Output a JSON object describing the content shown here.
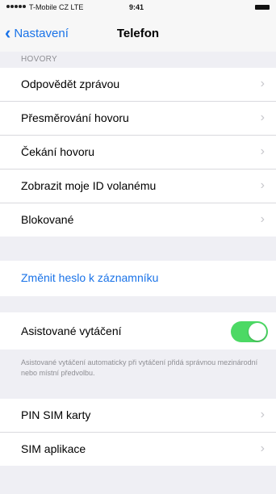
{
  "status": {
    "carrier": "T-Mobile CZ",
    "network": "LTE",
    "time": "9:41"
  },
  "nav": {
    "back_label": "Nastavení",
    "title": "Telefon"
  },
  "sections": {
    "calls_header": "HOVORY",
    "calls": [
      {
        "label": "Odpovědět zprávou"
      },
      {
        "label": "Přesměrování hovoru"
      },
      {
        "label": "Čekání hovoru"
      },
      {
        "label": "Zobrazit moje ID volanému"
      },
      {
        "label": "Blokované"
      }
    ],
    "voicemail_label": "Změnit heslo k záznamníku",
    "assist": {
      "label": "Asistované vytáčení",
      "enabled": true,
      "note": "Asistované vytáčení automaticky při vytáčení přidá správnou mezinárodní nebo místní předvolbu."
    },
    "sim": [
      {
        "label": "PIN SIM karty"
      },
      {
        "label": "SIM aplikace"
      }
    ]
  },
  "colors": {
    "accent": "#1a73e8",
    "toggle_on": "#4cd964",
    "background": "#efeff4"
  },
  "icons": {
    "back": "chevron-left-icon",
    "disclosure": "chevron-right-icon"
  }
}
